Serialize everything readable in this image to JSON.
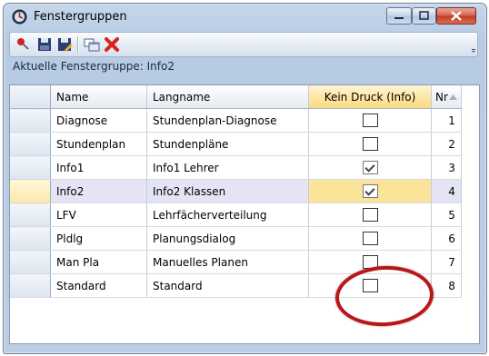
{
  "window": {
    "title": "Fenstergruppen",
    "icon": "clock-globe-icon"
  },
  "titlebar_buttons": [
    {
      "name": "minimize-button",
      "icon": "minimize-icon"
    },
    {
      "name": "maximize-button",
      "icon": "maximize-icon"
    },
    {
      "name": "close-button",
      "icon": "close-icon"
    }
  ],
  "toolbar": {
    "items": [
      {
        "name": "pin-button",
        "icon": "pushpin-icon"
      },
      {
        "name": "save-button",
        "icon": "save-icon"
      },
      {
        "name": "save-as-button",
        "icon": "save-edit-icon"
      },
      {
        "name": "window-list-button",
        "icon": "window-arrange-icon"
      },
      {
        "name": "delete-button",
        "icon": "red-x-icon"
      }
    ]
  },
  "current_group_label": "Aktuelle Fenstergruppe: Info2",
  "table": {
    "columns": [
      "Name",
      "Langname",
      "Kein Druck (Info)",
      "Nr"
    ],
    "sort_indicator": "sort-ascending-icon",
    "rows": [
      {
        "name": "Diagnose",
        "langname": "Stundenplan-Diagnose",
        "kein_druck": false,
        "nr": "1"
      },
      {
        "name": "Stundenplan",
        "langname": "Stundenpläne",
        "kein_druck": false,
        "nr": "2"
      },
      {
        "name": "Info1",
        "langname": "Info1 Lehrer",
        "kein_druck": true,
        "nr": "3"
      },
      {
        "name": "Info2",
        "langname": "Info2 Klassen",
        "kein_druck": true,
        "nr": "4",
        "selected": true
      },
      {
        "name": "LFV",
        "langname": "Lehrfächerverteilung",
        "kein_druck": false,
        "nr": "5"
      },
      {
        "name": "Pldlg",
        "langname": "Planungsdialog",
        "kein_druck": false,
        "nr": "6"
      },
      {
        "name": "Man Pla",
        "langname": "Manuelles Planen",
        "kein_druck": false,
        "nr": "7"
      },
      {
        "name": "Standard",
        "langname": "Standard",
        "kein_druck": false,
        "nr": "8"
      }
    ]
  },
  "annotation_color": "#b7171a"
}
